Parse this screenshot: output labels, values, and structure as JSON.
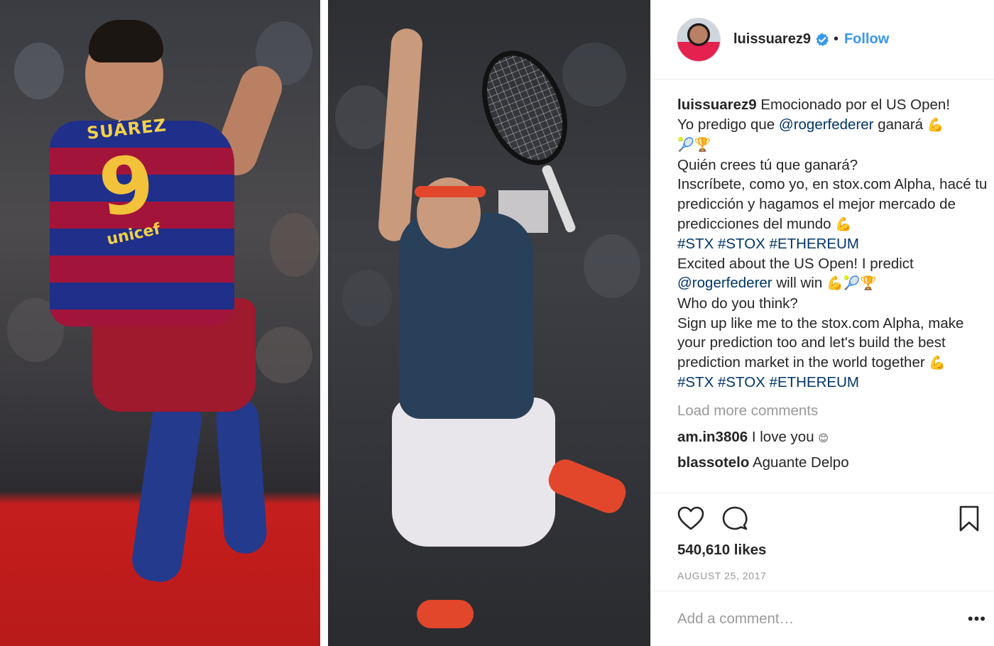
{
  "post": {
    "image_alt": "",
    "left_photo": {
      "jersey_name": "SUÁREZ",
      "jersey_number": "9",
      "sponsor": "unicef"
    }
  },
  "header": {
    "username": "luissuarez9",
    "separator": "•",
    "follow_label": "Follow",
    "verified_icon": "verified-badge-icon",
    "accent_color": "#3897f0"
  },
  "caption": {
    "username": "luissuarez9",
    "es_line1": "Emocionado por el US Open!",
    "es_line2a": "Yo predigo que",
    "mention1": "@rogerfederer",
    "es_line2b": "ganará",
    "es_line3": "Quién crees tú que ganará?",
    "es_line4": "Inscríbete, como yo, en stox.com Alpha, hacé tu predicción y hagamos el mejor mercado de predicciones del mundo",
    "hashtags_es": [
      "#STX",
      "#STOX",
      "#ETHEREUM"
    ],
    "en_line1": "Excited about the US Open! I predict",
    "mention2": "@rogerfederer",
    "en_line2": "will win",
    "en_line3": "Who do you think?",
    "en_line4": "Sign up like me to the stox.com Alpha, make your prediction too and let's build the best prediction market in the world together",
    "hashtags_en": [
      "#STX",
      "#STOX",
      "#ETHEREUM"
    ],
    "emoji": {
      "muscle": "💪",
      "racket": "🎾",
      "trophy": "🏆",
      "smile": "😊"
    }
  },
  "comments": {
    "load_more_label": "Load more comments",
    "items": [
      {
        "user": "am.in3806",
        "text": "I love you"
      },
      {
        "user": "blassotelo",
        "text": "Aguante Delpo"
      }
    ]
  },
  "actions": {
    "like_icon": "heart-icon",
    "comment_icon": "comment-bubble-icon",
    "save_icon": "bookmark-icon",
    "likes_label": "540,610 likes",
    "date_label": "AUGUST 25, 2017"
  },
  "add_comment": {
    "placeholder": "Add a comment…",
    "more_label": "•••"
  }
}
